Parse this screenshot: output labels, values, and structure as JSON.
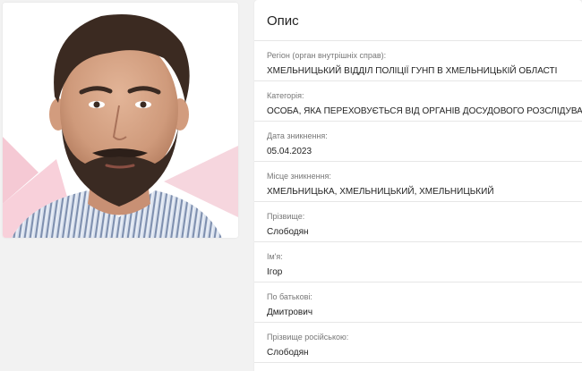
{
  "description": {
    "title": "Опис",
    "fields": [
      {
        "label": "Регіон (орган внутрішніх справ):",
        "value": "ХМЕЛЬНИЦЬКИЙ ВІДДІЛ ПОЛІЦІЇ ГУНП В ХМЕЛЬНИЦЬКІЙ ОБЛАСТІ"
      },
      {
        "label": "Категорія:",
        "value": "ОСОБА, ЯКА ПЕРЕХОВУЄТЬСЯ ВІД ОРГАНІВ ДОСУДОВОГО РОЗСЛІДУВАННЯ"
      },
      {
        "label": "Дата зникнення:",
        "value": "05.04.2023"
      },
      {
        "label": "Місце зникнення:",
        "value": "ХМЕЛЬНИЦЬКА, ХМЕЛЬНИЦЬКИЙ, ХМЕЛЬНИЦЬКИЙ"
      },
      {
        "label": "Прізвище:",
        "value": "Слободян"
      },
      {
        "label": "Ім'я:",
        "value": "Ігор"
      },
      {
        "label": "По батькові:",
        "value": "Дмитрович"
      },
      {
        "label": "Прізвище російською:",
        "value": "Слободян"
      }
    ]
  },
  "photo": {
    "icon": "person-photo"
  }
}
